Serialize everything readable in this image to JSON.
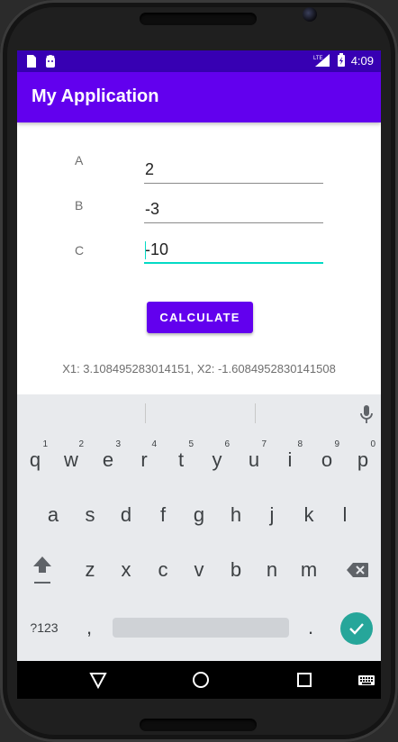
{
  "status_bar": {
    "time": "4:09",
    "network": "LTE",
    "icons": [
      "sd-card-icon",
      "android-debug-icon",
      "signal-icon",
      "battery-charging-icon"
    ]
  },
  "app": {
    "title": "My Application"
  },
  "form": {
    "fields": [
      {
        "label": "A",
        "value": "2"
      },
      {
        "label": "B",
        "value": "-3"
      },
      {
        "label": "C",
        "value": "-10"
      }
    ],
    "calculate_label": "CALCULATE",
    "result": "X1: 3.108495283014151, X2: -1.6084952830141508"
  },
  "keyboard": {
    "row1": [
      {
        "key": "q",
        "hint": "1"
      },
      {
        "key": "w",
        "hint": "2"
      },
      {
        "key": "e",
        "hint": "3"
      },
      {
        "key": "r",
        "hint": "4"
      },
      {
        "key": "t",
        "hint": "5"
      },
      {
        "key": "y",
        "hint": "6"
      },
      {
        "key": "u",
        "hint": "7"
      },
      {
        "key": "i",
        "hint": "8"
      },
      {
        "key": "o",
        "hint": "9"
      },
      {
        "key": "p",
        "hint": "0"
      }
    ],
    "row2": [
      "a",
      "s",
      "d",
      "f",
      "g",
      "h",
      "j",
      "k",
      "l"
    ],
    "row3": [
      "z",
      "x",
      "c",
      "v",
      "b",
      "n",
      "m"
    ],
    "symbols_label": "?123",
    "comma": ",",
    "period": "."
  },
  "colors": {
    "primary": "#6200ee",
    "primary_dark": "#3700b3",
    "accent": "#03dac5",
    "enter": "#26a69a"
  }
}
